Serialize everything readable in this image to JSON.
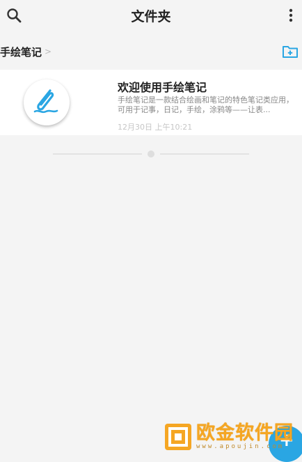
{
  "header": {
    "title": "文件夹",
    "search_icon": "search-icon",
    "more_icon": "more-vertical-icon"
  },
  "breadcrumb": {
    "current": "手绘笔记",
    "separator": ">",
    "action_icon": "new-folder-icon"
  },
  "notes": [
    {
      "title": "欢迎使用手绘笔记",
      "preview": "手绘笔记是一款结合绘画和笔记的特色笔记类应用，可用于记事，日记，手绘，涂鸦等——让表...",
      "date": "12月30日 上午10:21",
      "icon": "paperclip-pen-icon"
    }
  ],
  "pager": {
    "pages": 1,
    "current": 1
  },
  "fab": {
    "label": "+",
    "icon": "add-icon"
  },
  "watermark": {
    "text": "欧金软件园",
    "url": "www.apoujin.com",
    "logo_icon": "watermark-logo-icon"
  },
  "colors": {
    "background": "#f4f4f4",
    "accent": "#2aa6e3",
    "watermark": "#f5a623"
  }
}
